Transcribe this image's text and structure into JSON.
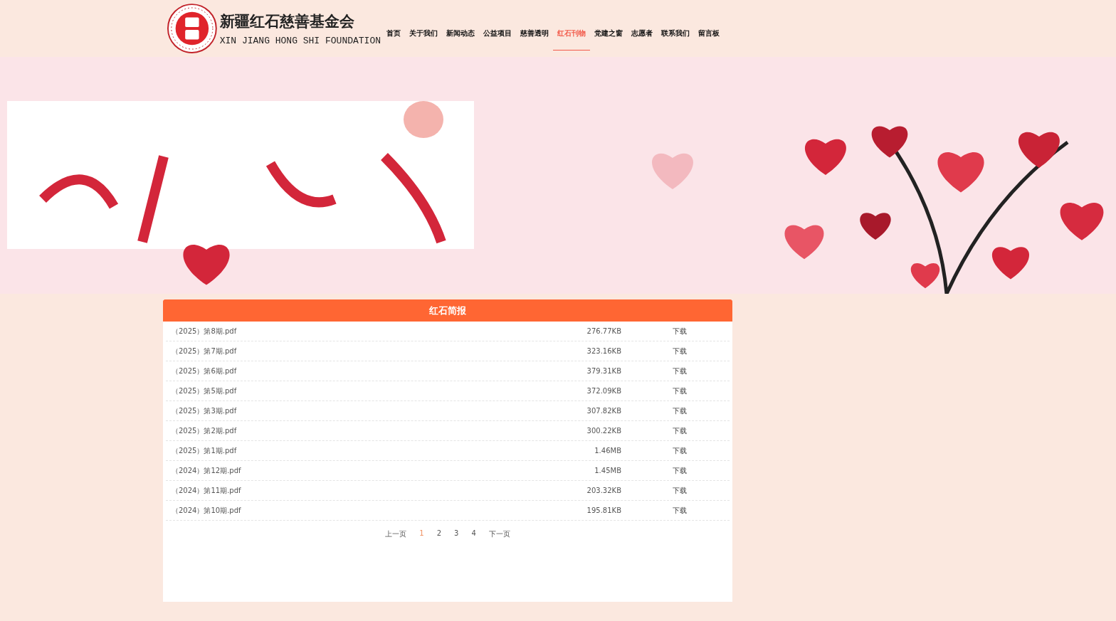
{
  "header": {
    "title": "新疆红石慈善基金会",
    "subtitle": "XIN JIANG HONG SHI FOUNDATION"
  },
  "nav": [
    {
      "label": "首页",
      "selected": false
    },
    {
      "label": "关于我们",
      "selected": false
    },
    {
      "label": "新闻动态",
      "selected": false
    },
    {
      "label": "公益项目",
      "selected": false
    },
    {
      "label": "慈善透明",
      "selected": false
    },
    {
      "label": "红石刊物",
      "selected": true
    },
    {
      "label": "党建之窗",
      "selected": false
    },
    {
      "label": "志愿者",
      "selected": false
    },
    {
      "label": "联系我们",
      "selected": false
    },
    {
      "label": "留言板",
      "selected": false
    }
  ],
  "panel": {
    "title": "红石简报",
    "files": [
      {
        "name": "（2025）第8期.pdf",
        "size": "276.77KB",
        "action": "下载"
      },
      {
        "name": "（2025）第7期.pdf",
        "size": "323.16KB",
        "action": "下载"
      },
      {
        "name": "（2025）第6期.pdf",
        "size": "379.31KB",
        "action": "下载"
      },
      {
        "name": "（2025）第5期.pdf",
        "size": "372.09KB",
        "action": "下载"
      },
      {
        "name": "（2025）第3期.pdf",
        "size": "307.82KB",
        "action": "下载"
      },
      {
        "name": "（2025）第2期.pdf",
        "size": "300.22KB",
        "action": "下载"
      },
      {
        "name": "（2025）第1期.pdf",
        "size": "1.46MB",
        "action": "下载"
      },
      {
        "name": "（2024）第12期.pdf",
        "size": "1.45MB",
        "action": "下载"
      },
      {
        "name": "（2024）第11期.pdf",
        "size": "203.32KB",
        "action": "下载"
      },
      {
        "name": "（2024）第10期.pdf",
        "size": "195.81KB",
        "action": "下载"
      }
    ],
    "pagination": {
      "prev": "上一页",
      "pages": [
        {
          "label": "1",
          "selected": true
        },
        {
          "label": "2",
          "selected": false
        },
        {
          "label": "3",
          "selected": false
        },
        {
          "label": "4",
          "selected": false
        }
      ],
      "next": "下一页"
    }
  }
}
